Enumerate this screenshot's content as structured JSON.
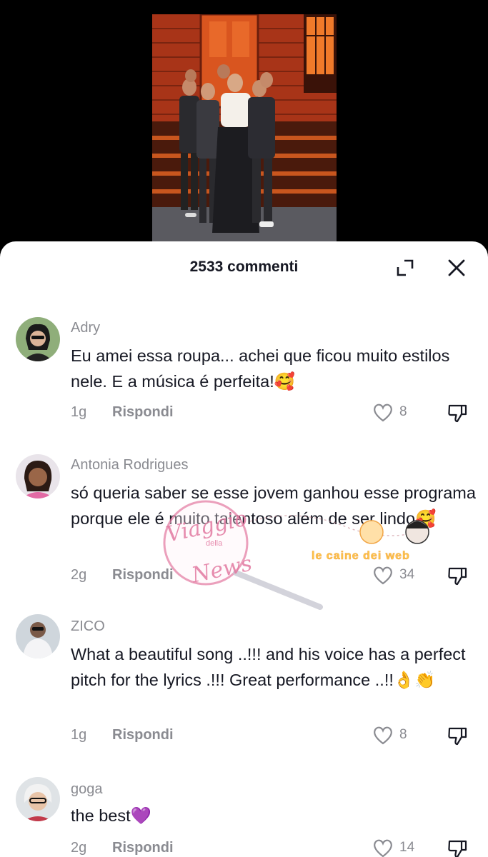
{
  "sheet": {
    "comment_count": "2533 commenti"
  },
  "comments": [
    {
      "username": "Adry",
      "text": "Eu amei essa roupa... achei que ficou muito estilos nele. E a música é perfeita!🥰",
      "time": "1g",
      "reply_label": "Rispondi",
      "likes": "8"
    },
    {
      "username": "Antonia Rodrigues",
      "text": "só queria saber se esse jovem ganhou esse programa porque ele é muito talentoso além de ser lindo🥰",
      "time": "2g",
      "reply_label": "Rispondi",
      "likes": "34"
    },
    {
      "username": "ZICO",
      "text": "What a beautiful song ..!!! and his voice has a perfect pitch for the lyrics .!!! Great performance ..!!👌👏",
      "time": "1g",
      "reply_label": "Rispondi",
      "likes": "8"
    },
    {
      "username": "goga",
      "text": "the best💜",
      "time": "2g",
      "reply_label": "Rispondi",
      "likes": "14"
    }
  ],
  "watermark": {
    "logo_line1": "Viaggio",
    "logo_small": "della",
    "logo_line2": "News",
    "right_text": "le caine dei web"
  },
  "icons": {
    "expand": "expand-icon",
    "close": "close-icon",
    "like": "heart-outline-icon",
    "dislike": "thumbs-down-icon"
  },
  "colors": {
    "text_primary": "#161823",
    "text_secondary": "#8a8b91",
    "sheet_bg": "#ffffff",
    "page_bg": "#000000"
  }
}
